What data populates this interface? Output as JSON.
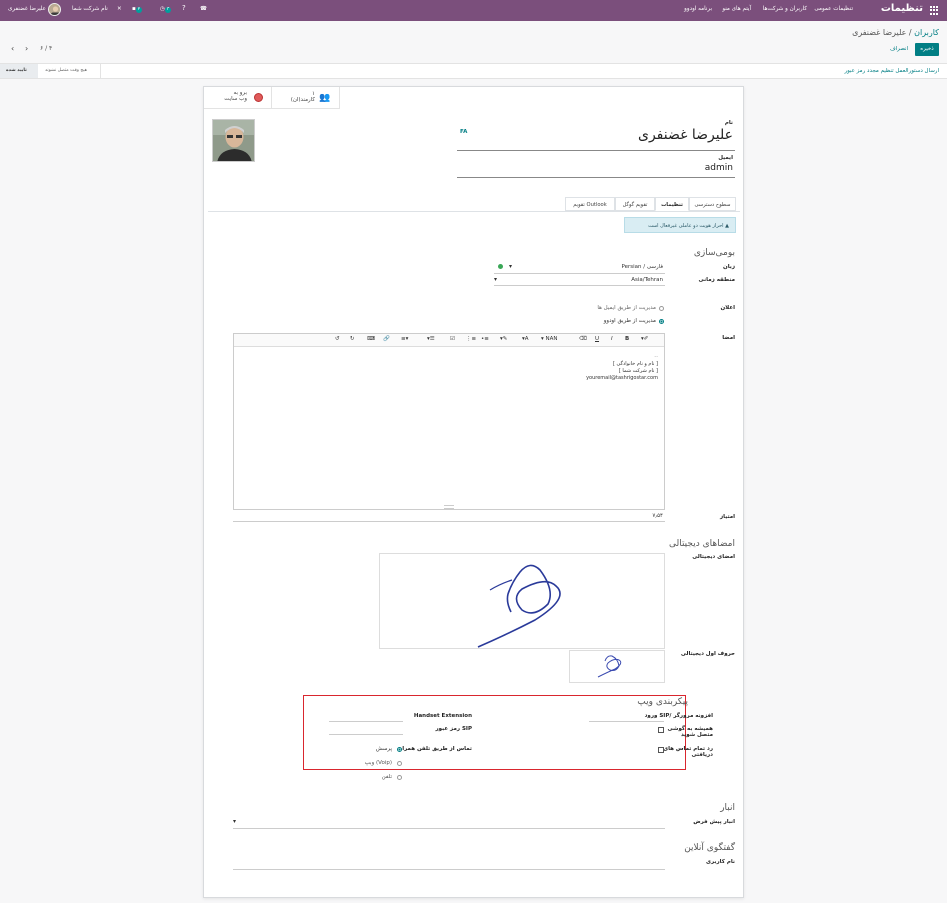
{
  "topbar": {
    "brand": "تنظیمات",
    "menu": [
      "تنظیمات عمومی",
      "کاربران و شرکت‌ها",
      "آیتم های منو",
      "برنامه اودوو"
    ],
    "company": "نام شرکت شما",
    "user": "علیرضا غضنفری",
    "badge_activity": "۳",
    "badge_chat": "۲"
  },
  "breadcrumb": {
    "parent": "کاربران",
    "separator": " / ",
    "current": "علیرضا غضنفری"
  },
  "buttons": {
    "save": "ذخیره",
    "discard": "انصراف"
  },
  "pager": {
    "value": "۶ / ۴"
  },
  "status": {
    "confirmed": "تایید شده",
    "never": "هیچ وقت متصل نشوند"
  },
  "action_link": "ارسال دستورالعمل تنظیم مجدد رمز عبور",
  "smart_buttons": {
    "employee_count": "۱",
    "employee_label": "کارمند(ان)",
    "website_line1": "برو به",
    "website_line2": "وب سایت"
  },
  "form": {
    "name_label": "نام",
    "name_value": "علیرضا غضنفری",
    "lang_code": "FA",
    "email_label": "ایمیل",
    "email_value": "admin"
  },
  "tabs": [
    "سطوح دسترسی",
    "تنظیمات",
    "تقویم گوگل",
    "تقویم Outlook"
  ],
  "alert": "احراز هویت دو عاملی غیرفعال است",
  "localization": {
    "title": "بومی‌سازی",
    "language_label": "زبان",
    "language_value": "Persian / فارسی",
    "timezone_label": "منطقه زمانی",
    "timezone_value": "Asia/Tehran"
  },
  "notification": {
    "label": "اعلان",
    "option_email": "مدیریت از طریق ایمیل ها",
    "option_odoo": "مدیریت از طریق اودوو"
  },
  "signature": {
    "label": "امضا",
    "toolbar": [
      "NAN",
      "A"
    ],
    "body_line1": "[ نام و نام خانوادگی ]",
    "body_line2": "[ نام شرکت شما ]",
    "body_line3": "youremail@tashrigostar.com"
  },
  "score": {
    "label": "امتیاز",
    "value": "۷٫۵۴"
  },
  "digital_signatures": {
    "title": "امضاهای دیجیتالی",
    "signature_label": "امضای دیجیتالی",
    "initials_label": "حروف اول دیجیتالی"
  },
  "voip": {
    "title": "پیکربندی ویپ",
    "sip_login_label": "ورود SIP/ افزونه مرورگر",
    "handset_label": "Handset Extension",
    "sip_password_label": "رمز عبور SIP",
    "mobile_label": "همیشه به گوشی متصل شوید",
    "reject_label": "رد تمام تماس های دریافتی",
    "mobile_call_label": "تماس از طریق تلفن همراه",
    "opt_ask": "پرسش",
    "opt_voip": "وبپ (Voip)",
    "opt_phone": "تلفن"
  },
  "inventory": {
    "title": "انبار",
    "default_label": "انبار پیش فرض"
  },
  "livechat": {
    "title": "گفتگوی آنلاین",
    "username_label": "نام کاربری"
  }
}
